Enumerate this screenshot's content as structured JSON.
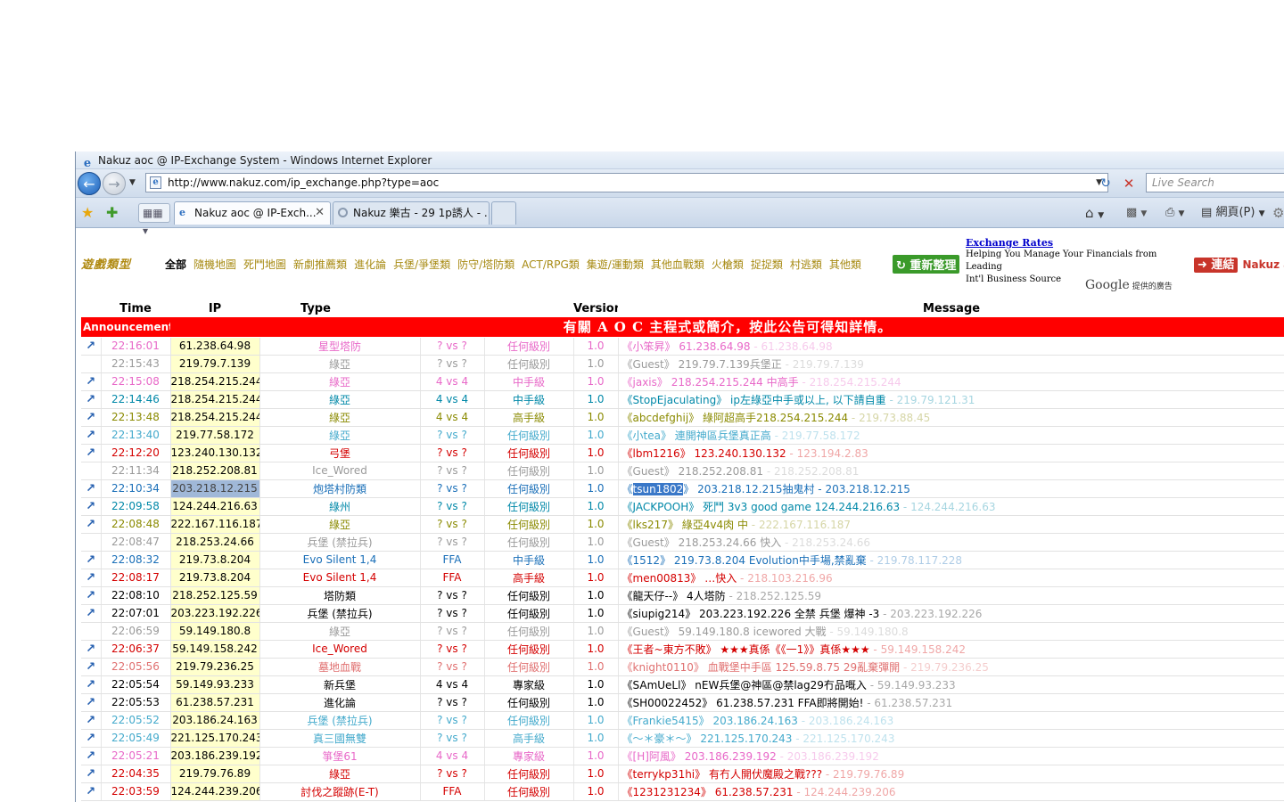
{
  "window": {
    "title": "Nakuz aoc @ IP-Exchange System - Windows Internet Explorer",
    "url": "http://www.nakuz.com/ip_exchange.php?type=aoc",
    "search_placeholder": "Live Search"
  },
  "tabs": [
    {
      "label": "Nakuz aoc @ IP-Exch..."
    },
    {
      "label": "Nakuz 樂古 - 29 1p誘人 - ..."
    }
  ],
  "toolbar": {
    "page_menu": "網頁(P)"
  },
  "filters": {
    "logo": "遊戲類型",
    "categories": [
      "全部",
      "隨機地圖",
      "死鬥地圖",
      "新劇推薦類",
      "進化論",
      "兵堡/爭堡類",
      "防守/塔防類",
      "ACT/RPG類",
      "集遊/運動類",
      "其他血戰類",
      "火槍類",
      "捉捉類",
      "村逃類",
      "其他類"
    ],
    "refresh_button": "重新整理",
    "link_button": "連結",
    "link_text": "Nakuz a"
  },
  "ad": {
    "headline": "Exchange Rates",
    "body_line1": "Helping You Manage Your Financials from Leading",
    "body_line2": "Int'l Business Source",
    "google": "Google",
    "google_sub": "提供的廣告"
  },
  "columns": {
    "time": "Time",
    "ip": "IP",
    "type": "Type",
    "version": "Version",
    "message": "Message"
  },
  "announcement": {
    "label": "Announcement",
    "text": "有關 A O C 主程式或簡介，按此公告可得知詳情。"
  },
  "colors": {
    "pink": "#e868c8",
    "gray": "#9a9a9a",
    "teal": "#0088a8",
    "olive": "#8a8a00",
    "cyan": "#44aacc",
    "red": "#d40000",
    "blue": "#1a6fb8",
    "black": "#000000",
    "salmon": "#e07070"
  },
  "rows": [
    {
      "icon": true,
      "time": "22:16:01",
      "ip": "61.238.64.98",
      "type": "星型塔防",
      "players": "? vs ?",
      "level": "任何級別",
      "version": "1.0",
      "user": "小笨昇",
      "msg": "61.238.64.98",
      "tail": "61.238.64.98",
      "color": "pink"
    },
    {
      "icon": false,
      "time": "22:15:43",
      "ip": "219.79.7.139",
      "type": "綠亞",
      "players": "? vs ?",
      "level": "任何級別",
      "version": "1.0",
      "user": "Guest",
      "msg": "219.79.7.139兵堡正",
      "tail": "219.79.7.139",
      "color": "gray"
    },
    {
      "icon": true,
      "time": "22:15:08",
      "ip": "218.254.215.244",
      "type": "綠亞",
      "players": "4 vs 4",
      "level": "中手級",
      "version": "1.0",
      "user": "jaxis",
      "msg": "218.254.215.244 中高手",
      "tail": "218.254.215.244",
      "color": "pink"
    },
    {
      "icon": true,
      "time": "22:14:46",
      "ip": "218.254.215.244",
      "type": "綠亞",
      "players": "4 vs 4",
      "level": "中手級",
      "version": "1.0",
      "user": "StopEjaculating",
      "msg": "ip左綠亞中手或以上, 以下請自重",
      "tail": "219.79.121.31",
      "color": "teal"
    },
    {
      "icon": true,
      "time": "22:13:48",
      "ip": "218.254.215.244",
      "type": "綠亞",
      "players": "4 vs 4",
      "level": "高手級",
      "version": "1.0",
      "user": "abcdefghij",
      "msg": "綠阿超高手218.254.215.244",
      "tail": "219.73.88.45",
      "color": "olive"
    },
    {
      "icon": true,
      "time": "22:13:40",
      "ip": "219.77.58.172",
      "type": "綠亞",
      "players": "? vs ?",
      "level": "任何級別",
      "version": "1.0",
      "user": "小tea",
      "msg": "連開神區兵堡真正高",
      "tail": "219.77.58.172",
      "color": "cyan"
    },
    {
      "icon": true,
      "time": "22:12:20",
      "ip": "123.240.130.132",
      "type": "弓堡",
      "players": "? vs ?",
      "level": "任何級別",
      "version": "1.0",
      "user": "lbm1216",
      "msg": "123.240.130.132",
      "tail": "123.194.2.83",
      "color": "red"
    },
    {
      "icon": false,
      "time": "22:11:34",
      "ip": "218.252.208.81",
      "type": "Ice_Wored",
      "players": "? vs ?",
      "level": "任何級別",
      "version": "1.0",
      "user": "Guest",
      "msg": "218.252.208.81",
      "tail": "218.252.208.81",
      "color": "gray"
    },
    {
      "icon": true,
      "time": "22:10:34",
      "ip": "203.218.12.215",
      "type": "炮塔村防類",
      "players": "? vs ?",
      "level": "任何級別",
      "version": "1.0",
      "user": "tsun1802",
      "msg": "203.218.12.215抽鬼村 - 203.218.12.215",
      "tail": "",
      "color": "blue",
      "selected": true
    },
    {
      "icon": true,
      "time": "22:09:58",
      "ip": "124.244.216.63",
      "type": "綠州",
      "players": "? vs ?",
      "level": "任何級別",
      "version": "1.0",
      "user": "JACKPOOH",
      "msg": "死鬥 3v3 good game 124.244.216.63",
      "tail": "124.244.216.63",
      "color": "teal"
    },
    {
      "icon": true,
      "time": "22:08:48",
      "ip": "222.167.116.187",
      "type": "綠亞",
      "players": "? vs ?",
      "level": "任何級別",
      "version": "1.0",
      "user": "lks217",
      "msg": "綠亞4v4肉 中",
      "tail": "222.167.116.187",
      "color": "olive"
    },
    {
      "icon": false,
      "time": "22:08:47",
      "ip": "218.253.24.66",
      "type": "兵堡 (禁拉兵)",
      "players": "? vs ?",
      "level": "任何級別",
      "version": "1.0",
      "user": "Guest",
      "msg": "218.253.24.66 快入",
      "tail": "218.253.24.66",
      "color": "gray"
    },
    {
      "icon": true,
      "time": "22:08:32",
      "ip": "219.73.8.204",
      "type": "Evo Silent 1,4",
      "players": "FFA",
      "level": "中手級",
      "version": "1.0",
      "user": "1512",
      "msg": "219.73.8.204 Evolution中手場,禁亂棄",
      "tail": "219.78.117.228",
      "color": "blue"
    },
    {
      "icon": true,
      "time": "22:08:17",
      "ip": "219.73.8.204",
      "type": "Evo Silent 1,4",
      "players": "FFA",
      "level": "高手級",
      "version": "1.0",
      "user": "men00813",
      "msg": "…快入",
      "tail": "218.103.216.96",
      "color": "red"
    },
    {
      "icon": true,
      "time": "22:08:10",
      "ip": "218.252.125.59",
      "type": "塔防類",
      "players": "? vs ?",
      "level": "任何級別",
      "version": "1.0",
      "user": "龍天仔--",
      "msg": "4人塔防",
      "tail": "218.252.125.59",
      "color": "black"
    },
    {
      "icon": true,
      "time": "22:07:01",
      "ip": "203.223.192.226",
      "type": "兵堡 (禁拉兵)",
      "players": "? vs ?",
      "level": "任何級別",
      "version": "1.0",
      "user": "siupig214",
      "msg": "203.223.192.226 全禁 兵堡 爆神 -3",
      "tail": "203.223.192.226",
      "color": "black"
    },
    {
      "icon": false,
      "time": "22:06:59",
      "ip": "59.149.180.8",
      "type": "綠亞",
      "players": "? vs ?",
      "level": "任何級別",
      "version": "1.0",
      "user": "Guest",
      "msg": "59.149.180.8 icewored 大戰",
      "tail": "59.149.180.8",
      "color": "gray"
    },
    {
      "icon": true,
      "time": "22:06:37",
      "ip": "59.149.158.242",
      "type": "Ice_Wored",
      "players": "? vs ?",
      "level": "任何級別",
      "version": "1.0",
      "user": "王者~東方不敗",
      "msg": "★★★真係《《一1》》真係★★★",
      "tail": "59.149.158.242",
      "color": "red"
    },
    {
      "icon": true,
      "time": "22:05:56",
      "ip": "219.79.236.25",
      "type": "墓地血戰",
      "players": "? vs ?",
      "level": "任何級別",
      "version": "1.0",
      "user": "knight0110",
      "msg": "血戰堡中手區 125.59.8.75 29亂棄彈開",
      "tail": "219.79.236.25",
      "color": "salmon"
    },
    {
      "icon": true,
      "time": "22:05:54",
      "ip": "59.149.93.233",
      "type": "新兵堡",
      "players": "4 vs 4",
      "level": "專家級",
      "version": "1.0",
      "user": "SAmUeLl",
      "msg": "nEW兵堡@神區@禁lag29冇品嘅入",
      "tail": "59.149.93.233",
      "color": "black"
    },
    {
      "icon": true,
      "time": "22:05:53",
      "ip": "61.238.57.231",
      "type": "進化論",
      "players": "? vs ?",
      "level": "任何級別",
      "version": "1.0",
      "user": "SH00022452",
      "msg": "61.238.57.231 FFA即將開始!",
      "tail": "61.238.57.231",
      "color": "black"
    },
    {
      "icon": true,
      "time": "22:05:52",
      "ip": "203.186.24.163",
      "type": "兵堡 (禁拉兵)",
      "players": "? vs ?",
      "level": "任何級別",
      "version": "1.0",
      "user": "Frankie5415",
      "msg": "203.186.24.163",
      "tail": "203.186.24.163",
      "color": "cyan"
    },
    {
      "icon": true,
      "time": "22:05:49",
      "ip": "221.125.170.243",
      "type": "真三國無雙",
      "players": "? vs ?",
      "level": "高手級",
      "version": "1.0",
      "user": "～＊豪＊～",
      "msg": "221.125.170.243",
      "tail": "221.125.170.243",
      "color": "cyan"
    },
    {
      "icon": true,
      "time": "22:05:21",
      "ip": "203.186.239.192",
      "type": "箏堡61",
      "players": "4 vs 4",
      "level": "專家級",
      "version": "1.0",
      "user": "[H]阿風",
      "msg": "203.186.239.192",
      "tail": "203.186.239.192",
      "color": "pink"
    },
    {
      "icon": true,
      "time": "22:04:35",
      "ip": "219.79.76.89",
      "type": "綠亞",
      "players": "? vs ?",
      "level": "任何級別",
      "version": "1.0",
      "user": "terrykp31hi",
      "msg": "有冇人開伏魔殿之戰???",
      "tail": "219.79.76.89",
      "color": "red"
    },
    {
      "icon": true,
      "time": "22:03:59",
      "ip": "124.244.239.206",
      "type": "討伐之蹤跡(E-T)",
      "players": "FFA",
      "level": "任何級別",
      "version": "1.0",
      "user": "1231231234",
      "msg": "61.238.57.231",
      "tail": "124.244.239.206",
      "color": "red"
    }
  ]
}
